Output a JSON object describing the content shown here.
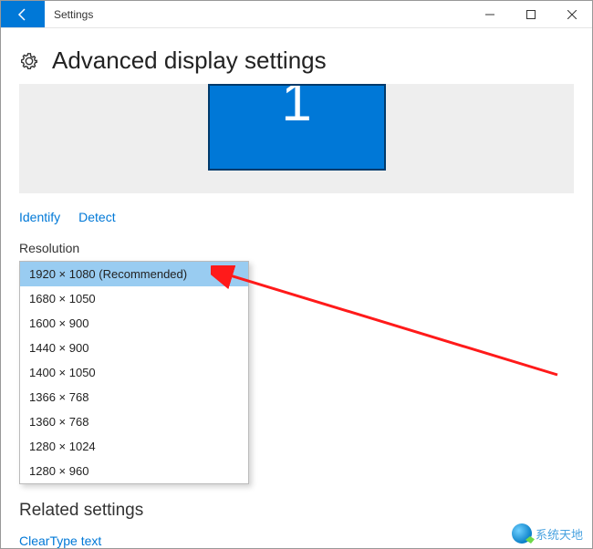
{
  "window": {
    "title": "Settings"
  },
  "page": {
    "heading": "Advanced display settings",
    "monitor_number": "1"
  },
  "links": {
    "identify": "Identify",
    "detect": "Detect"
  },
  "resolution": {
    "label": "Resolution",
    "options": [
      "1920 × 1080 (Recommended)",
      "1680 × 1050",
      "1600 × 900",
      "1440 × 900",
      "1400 × 1050",
      "1366 × 768",
      "1360 × 768",
      "1280 × 1024",
      "1280 × 960"
    ]
  },
  "related": {
    "heading": "Related settings",
    "cleartype": "ClearType text"
  },
  "watermark": "系统天地"
}
